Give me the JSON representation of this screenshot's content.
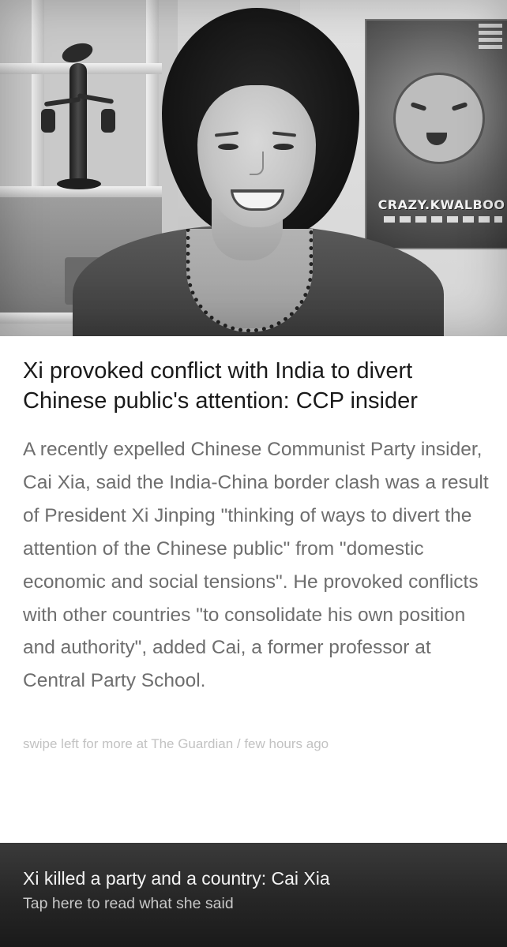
{
  "article": {
    "headline": "Xi provoked conflict with India to divert Chinese public's attention: CCP insider",
    "summary": "A recently expelled Chinese Communist Party insider, Cai Xia, said the India-China border clash was a result of President Xi Jinping \"thinking of ways to divert the attention of the Chinese public\" from \"domestic economic and social tensions\". He provoked conflicts with other countries \"to consolidate his own position and authority\", added Cai, a former professor at Central Party School.",
    "source_line": "swipe left for more at The Guardian / few hours ago"
  },
  "hero": {
    "poster_text": "CRAZY.KWALBOO"
  },
  "bottom_bar": {
    "title": "Xi killed a party and a country: Cai Xia",
    "subtitle": "Tap here to read what she said"
  },
  "colors": {
    "background": "#ffffff",
    "headline": "#1a1a1a",
    "summary": "#6e6e6e",
    "source_line": "#c2c2c2",
    "bottom_bar": "#262626"
  }
}
